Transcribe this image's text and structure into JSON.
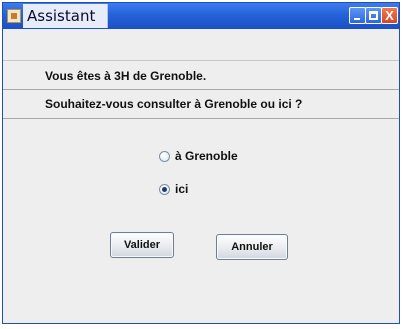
{
  "window": {
    "title": "Assistant",
    "close_glyph": "X"
  },
  "messages": {
    "line1": "Vous êtes à 3H de Grenoble.",
    "line2": "Souhaitez-vous consulter à Grenoble ou ici ?"
  },
  "options": [
    {
      "label": "à Grenoble",
      "selected": false
    },
    {
      "label": "ici",
      "selected": true
    }
  ],
  "buttons": {
    "validate_label": "Valider",
    "cancel_label": "Annuler"
  },
  "icons": {
    "app": "java-cup-icon",
    "minimize": "minimize-icon",
    "maximize": "maximize-icon",
    "close": "close-icon"
  }
}
